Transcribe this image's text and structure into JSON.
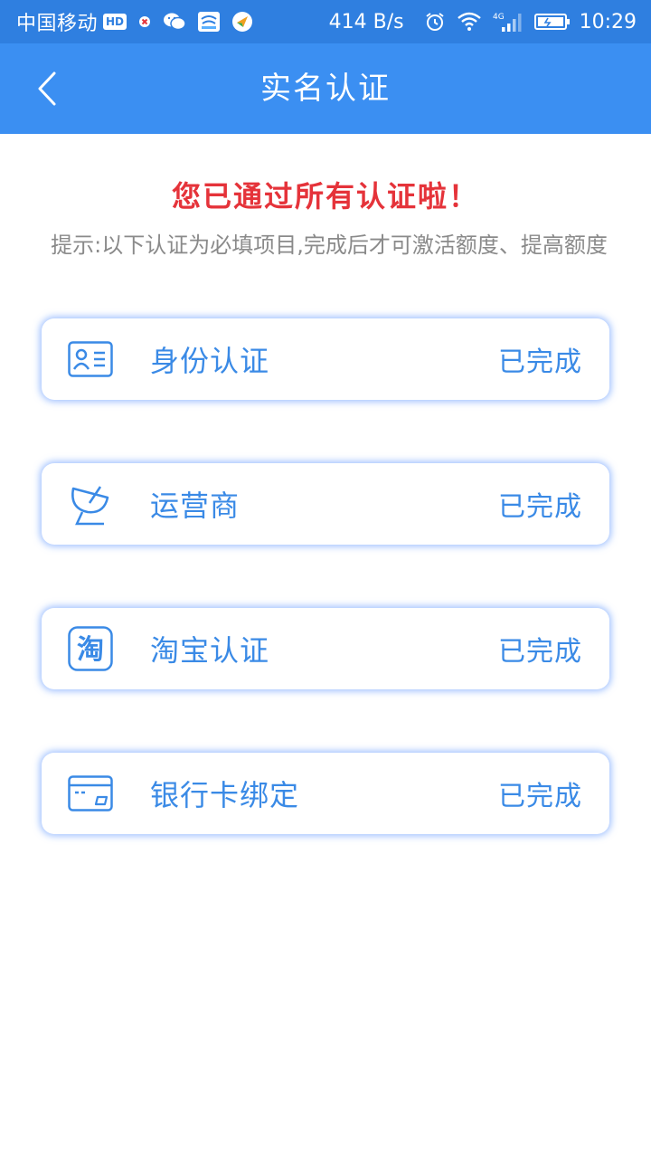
{
  "status_bar": {
    "carrier": "中国移动",
    "hd": "HD",
    "net_speed": "414 B/s",
    "network": "4G",
    "time": "10:29"
  },
  "nav": {
    "title": "实名认证",
    "back_icon": "chevron-left-icon"
  },
  "header": {
    "success_message": "您已通过所有认证啦！",
    "hint": "提示:以下认证为必填项目,完成后才可激活额度、提高额度"
  },
  "items": [
    {
      "label": "身份认证",
      "status": "已完成",
      "icon": "id-card-icon"
    },
    {
      "label": "运营商",
      "status": "已完成",
      "icon": "satellite-dish-icon"
    },
    {
      "label": "淘宝认证",
      "status": "已完成",
      "icon": "taobao-icon",
      "icon_text": "淘"
    },
    {
      "label": "银行卡绑定",
      "status": "已完成",
      "icon": "bank-card-icon"
    }
  ],
  "colors": {
    "status_bar": "#2f7fe0",
    "nav_bar": "#3b8ff2",
    "success": "#e5333a",
    "accent": "#3a8ae6",
    "hint": "#8a8a8a"
  }
}
